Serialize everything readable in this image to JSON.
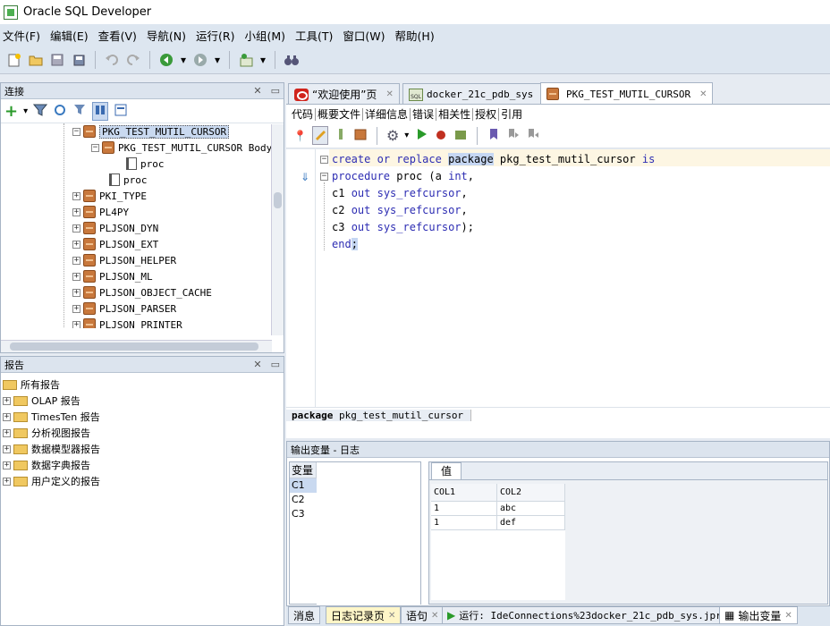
{
  "app": {
    "title": "Oracle SQL Developer"
  },
  "menu": [
    "文件(F)",
    "编辑(E)",
    "查看(V)",
    "导航(N)",
    "运行(R)",
    "小组(M)",
    "工具(T)",
    "窗口(W)",
    "帮助(H)"
  ],
  "toolbar_icons": [
    "new-icon",
    "open-icon",
    "save-icon",
    "save-all-icon",
    "undo-icon",
    "redo-icon",
    "back-icon",
    "forward-icon",
    "sql-worksheet-icon",
    "binoculars-icon"
  ],
  "connections": {
    "title": "连接",
    "tree": [
      {
        "label": "PKG_TEST_MUTIL_CURSOR",
        "level": 0,
        "type": "package",
        "expanded": true,
        "selected": true
      },
      {
        "label": "PKG_TEST_MUTIL_CURSOR Body",
        "level": 1,
        "type": "package",
        "expanded": true
      },
      {
        "label": "proc",
        "level": 2,
        "type": "proc"
      },
      {
        "label": "proc",
        "level": 1,
        "type": "proc"
      },
      {
        "label": "PKI_TYPE",
        "level": 0,
        "type": "package"
      },
      {
        "label": "PL4PY",
        "level": 0,
        "type": "package"
      },
      {
        "label": "PLJSON_DYN",
        "level": 0,
        "type": "package"
      },
      {
        "label": "PLJSON_EXT",
        "level": 0,
        "type": "package"
      },
      {
        "label": "PLJSON_HELPER",
        "level": 0,
        "type": "package"
      },
      {
        "label": "PLJSON_ML",
        "level": 0,
        "type": "package"
      },
      {
        "label": "PLJSON_OBJECT_CACHE",
        "level": 0,
        "type": "package"
      },
      {
        "label": "PLJSON_PARSER",
        "level": 0,
        "type": "package"
      },
      {
        "label": "PLJSON_PRINTER",
        "level": 0,
        "type": "package"
      }
    ]
  },
  "reports": {
    "title": "报告",
    "root": "所有报告",
    "items": [
      "OLAP 报告",
      "TimesTen 报告",
      "分析视图报告",
      "数据模型器报告",
      "数据字典报告",
      "用户定义的报告"
    ]
  },
  "editor_tabs": [
    {
      "label": "“欢迎使用”页",
      "icon": "oracle-icon",
      "active": false
    },
    {
      "label": "docker_21c_pdb_sys",
      "icon": "sql-worksheet-icon",
      "active": false
    },
    {
      "label": "PKG_TEST_MUTIL_CURSOR",
      "icon": "package-icon",
      "active": true
    }
  ],
  "sub_tabs": [
    "代码",
    "概要文件",
    "详细信息",
    "错误",
    "相关性",
    "授权",
    "引用"
  ],
  "code": [
    "create or replace package pkg_test_mutil_cursor is",
    "procedure proc (a int,",
    "c1 out sys_refcursor,",
    "c2 out sys_refcursor,",
    "c3 out sys_refcursor);",
    "end;"
  ],
  "breadcrumb": {
    "keyword": "package",
    "name": "pkg_test_mutil_cursor"
  },
  "output": {
    "title": "输出变量 - 日志",
    "var_header": "变量",
    "variables": [
      "C1",
      "C2",
      "C3"
    ],
    "selected_variable": "C1",
    "value_tab": "值",
    "columns": [
      "COL1",
      "COL2"
    ],
    "rows": [
      [
        "1",
        "abc"
      ],
      [
        "1",
        "def"
      ]
    ]
  },
  "bottom_tabs": [
    {
      "label": "消息",
      "closable": false
    },
    {
      "label": "日志记录页",
      "closable": true
    },
    {
      "label": "语句",
      "closable": true
    },
    {
      "label": "运行: IdeConnections%23docker_21c_pdb_sys.jpr",
      "closable": true
    },
    {
      "label": "输出变量",
      "closable": true,
      "active": true
    }
  ]
}
